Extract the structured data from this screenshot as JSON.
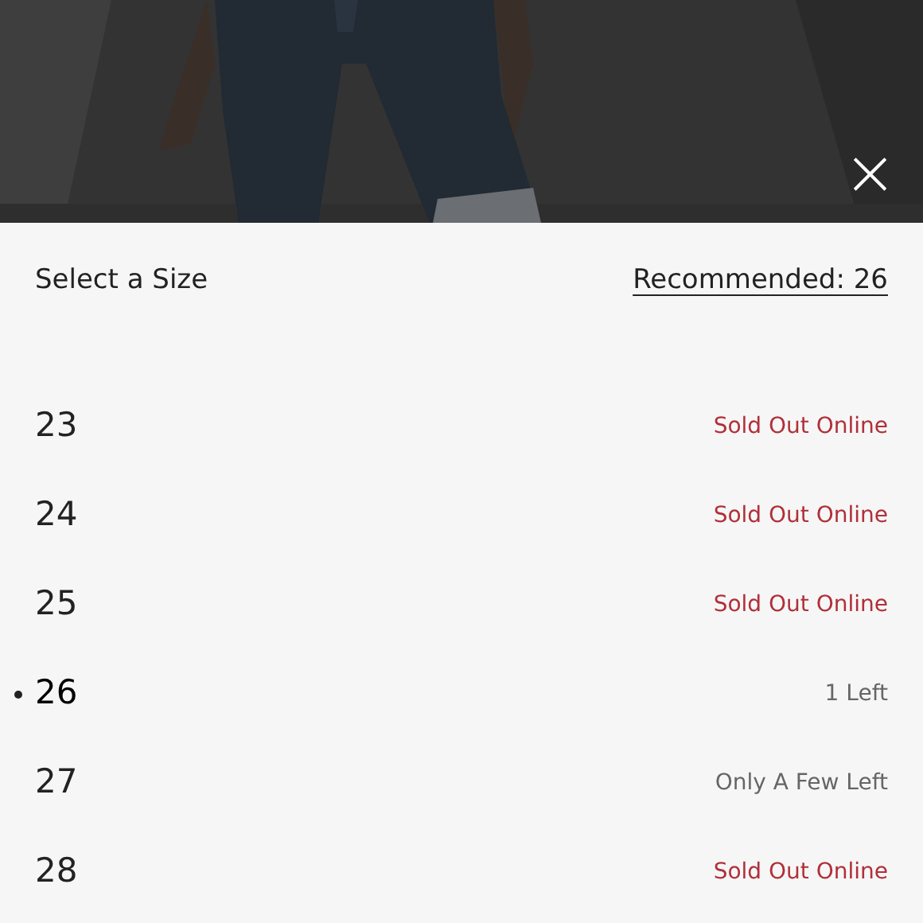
{
  "close": {
    "label": "×"
  },
  "header": {
    "title": "Select a Size",
    "recommended": "Recommended: 26"
  },
  "sizes": [
    {
      "size": "23",
      "status": "Sold Out Online",
      "kind": "sold_out",
      "selected": false
    },
    {
      "size": "24",
      "status": "Sold Out Online",
      "kind": "sold_out",
      "selected": false
    },
    {
      "size": "25",
      "status": "Sold Out Online",
      "kind": "sold_out",
      "selected": false
    },
    {
      "size": "26",
      "status": "1 Left",
      "kind": "low",
      "selected": true
    },
    {
      "size": "27",
      "status": "Only A Few Left",
      "kind": "low",
      "selected": false
    },
    {
      "size": "28",
      "status": "Sold Out Online",
      "kind": "sold_out",
      "selected": false
    }
  ]
}
